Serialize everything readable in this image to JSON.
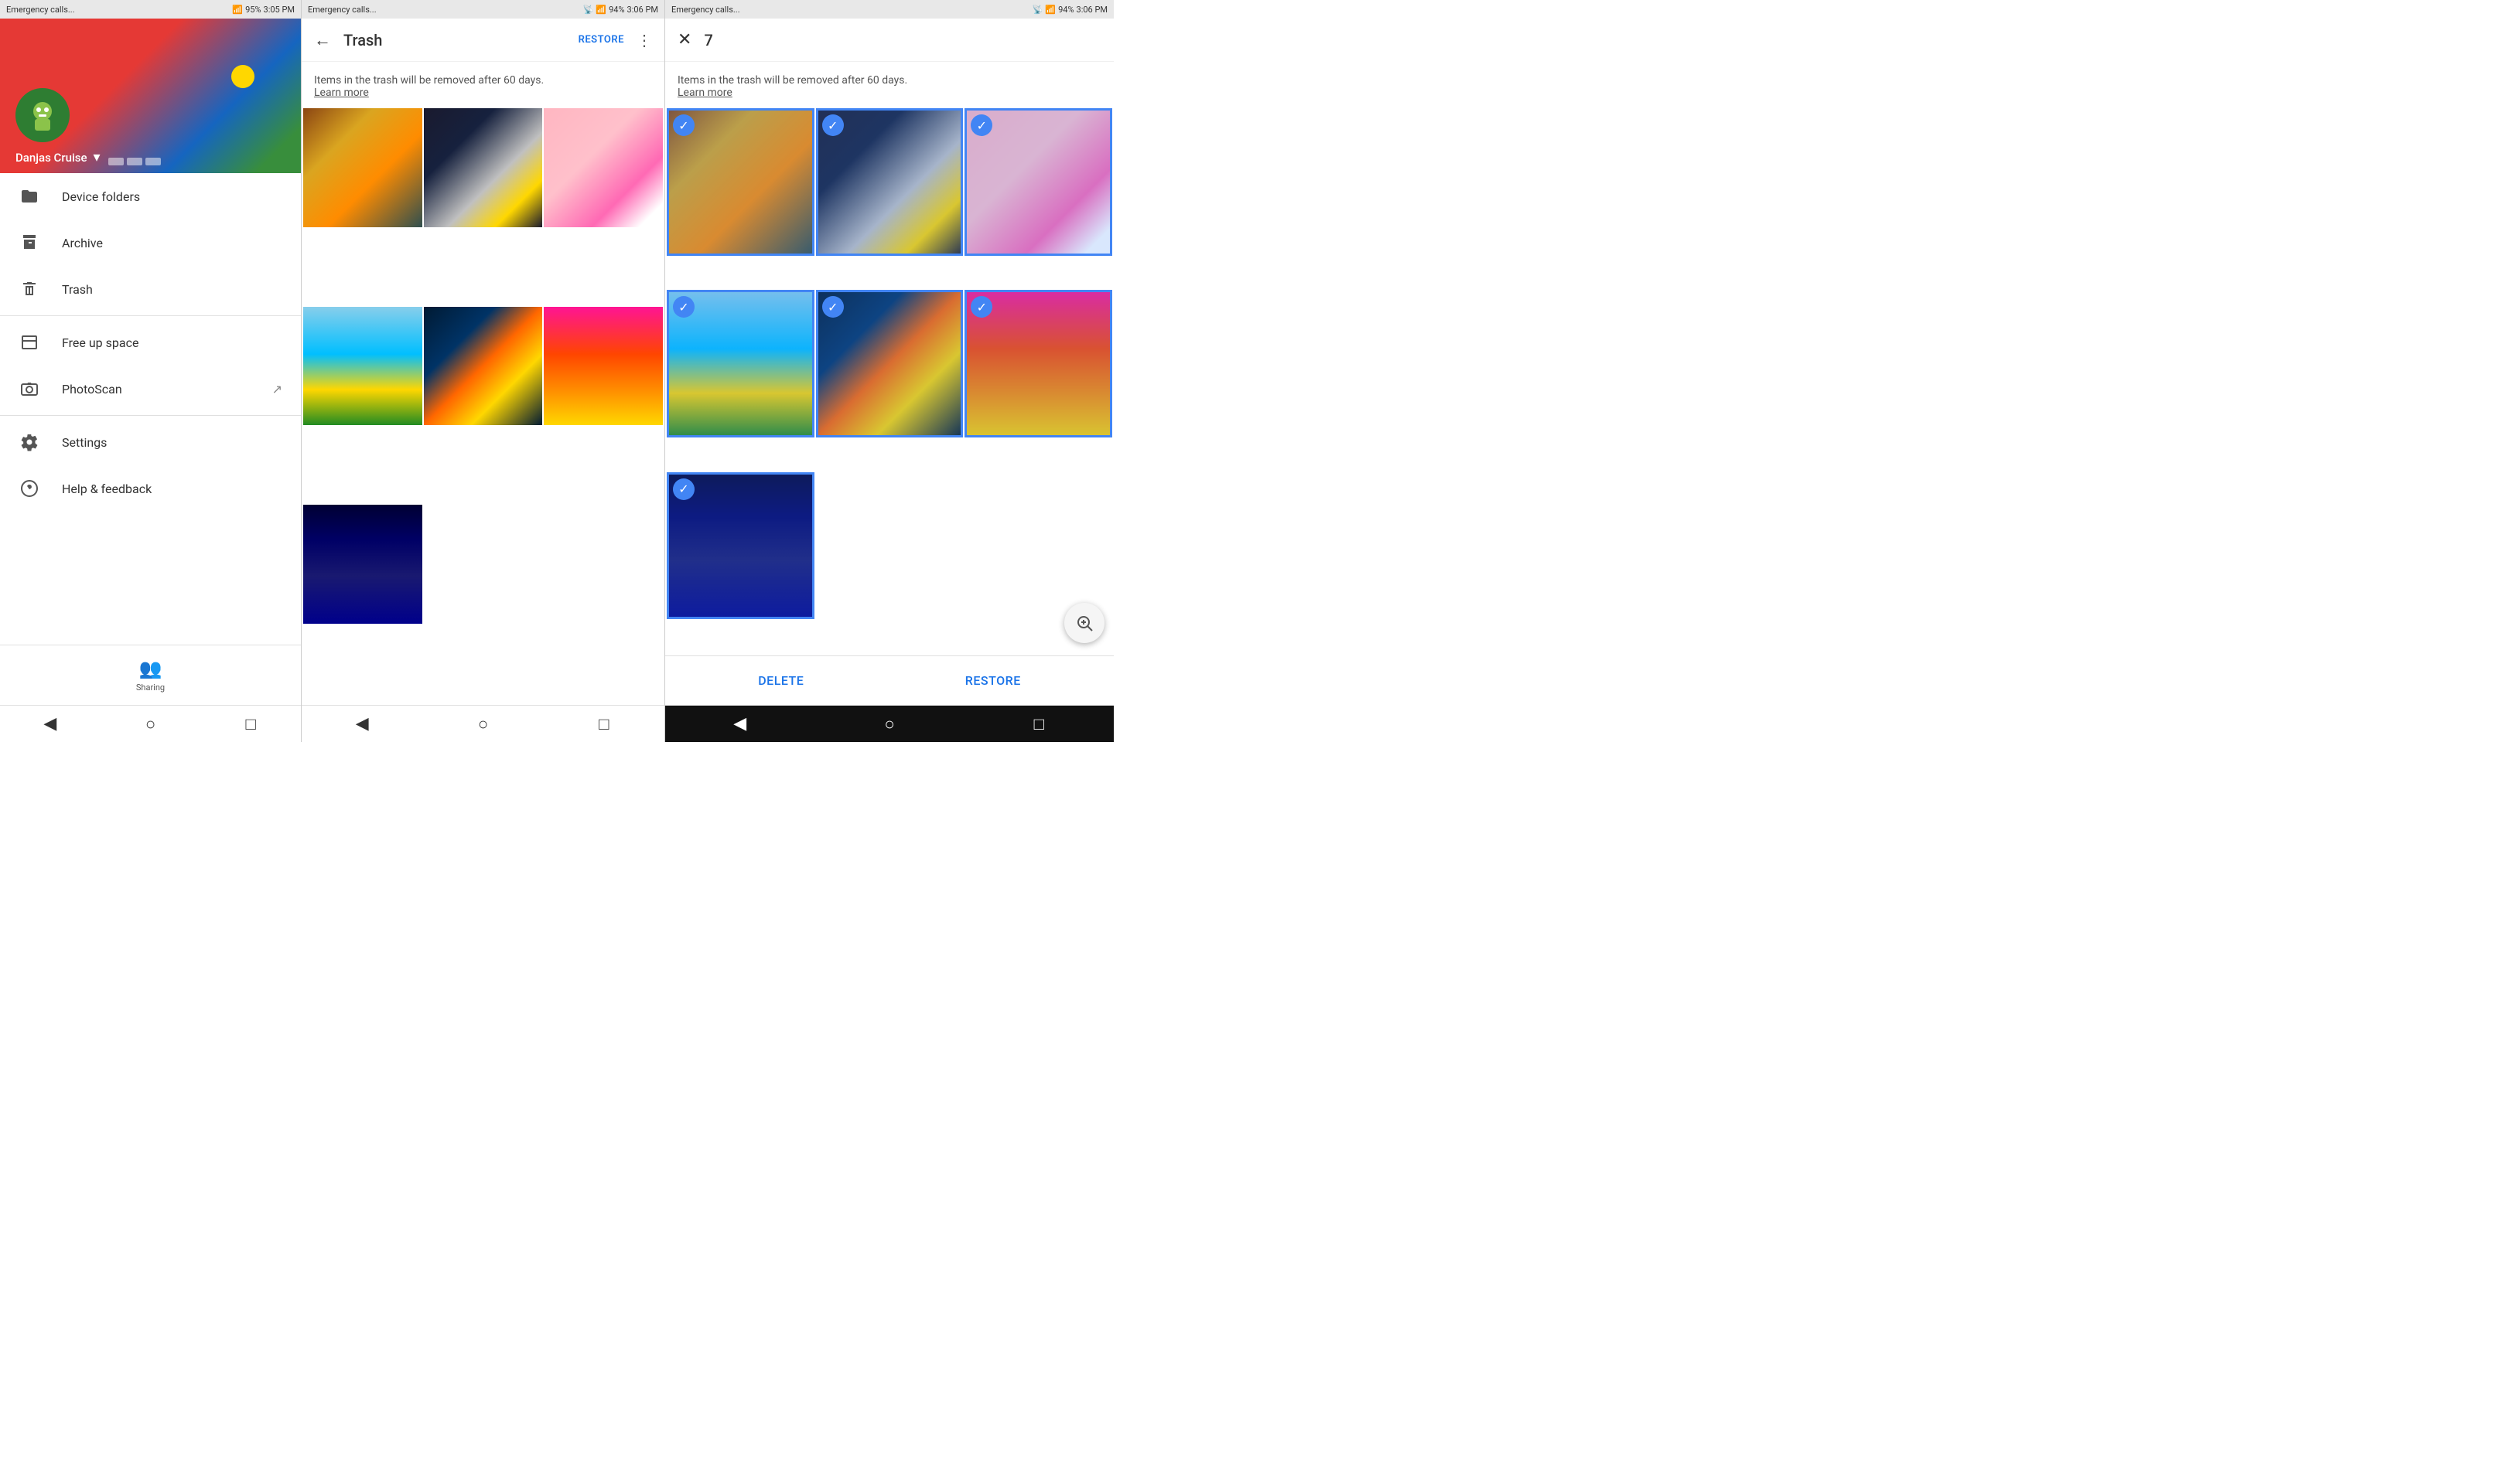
{
  "panels": {
    "left": {
      "status": {
        "left": "Emergency calls...",
        "time": "3:05 PM",
        "battery": "95%"
      },
      "user": {
        "name": "Danjas Cruise"
      },
      "nav": [
        {
          "id": "device-folders",
          "icon": "📁",
          "label": "Device folders"
        },
        {
          "id": "archive",
          "icon": "⬇",
          "label": "Archive"
        },
        {
          "id": "trash",
          "icon": "🗑",
          "label": "Trash"
        },
        {
          "id": "free-up-space",
          "icon": "📋",
          "label": "Free up space"
        },
        {
          "id": "photoscan",
          "icon": "📷",
          "label": "PhotoScan",
          "external": true
        },
        {
          "id": "settings",
          "icon": "⚙",
          "label": "Settings"
        },
        {
          "id": "help-feedback",
          "icon": "❓",
          "label": "Help & feedback"
        }
      ],
      "sharing": "Sharing"
    },
    "middle": {
      "status": {
        "left": "Emergency calls...",
        "time": "3:06 PM",
        "battery": "94%"
      },
      "header": {
        "title": "Trash",
        "restoreLabel": "RESTORE"
      },
      "info": "Items in the trash will be removed after 60 days.",
      "learnMore": "Learn more",
      "photos": [
        {
          "id": "autumn",
          "class": "photo-autumn"
        },
        {
          "id": "crystal",
          "class": "photo-crystal"
        },
        {
          "id": "flowers",
          "class": "photo-flowers"
        },
        {
          "id": "ocean",
          "class": "photo-ocean"
        },
        {
          "id": "fish",
          "class": "photo-fish"
        },
        {
          "id": "sunset",
          "class": "photo-sunset"
        },
        {
          "id": "galaxy",
          "class": "photo-galaxy"
        }
      ]
    },
    "right": {
      "status": {
        "left": "Emergency calls...",
        "time": "3:06 PM",
        "battery": "94%"
      },
      "header": {
        "count": "7"
      },
      "info": "Items in the trash will be removed after 60 days.",
      "learnMore": "Learn more",
      "photos": [
        {
          "id": "autumn-sel",
          "class": "photo-autumn",
          "selected": true
        },
        {
          "id": "crystal-sel",
          "class": "photo-crystal",
          "selected": true
        },
        {
          "id": "flowers-sel",
          "class": "photo-flowers",
          "selected": true
        },
        {
          "id": "ocean-sel",
          "class": "photo-ocean",
          "selected": true
        },
        {
          "id": "fish-sel",
          "class": "photo-fish",
          "selected": true
        },
        {
          "id": "sunset-sel",
          "class": "photo-sunset",
          "selected": true
        },
        {
          "id": "galaxy-sel",
          "class": "photo-galaxy",
          "selected": true
        }
      ],
      "actions": {
        "delete": "Delete",
        "restore": "Restore"
      }
    }
  },
  "navBar": {
    "back": "◀",
    "home": "○",
    "recent": "□"
  }
}
